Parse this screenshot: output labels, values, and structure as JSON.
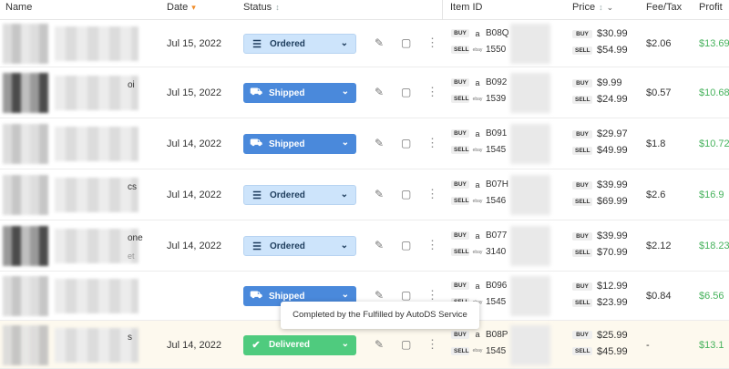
{
  "header": {
    "name": "Name",
    "date": "Date",
    "status": "Status",
    "item_id": "Item ID",
    "price": "Price",
    "fee_tax": "Fee/Tax",
    "profit": "Profit"
  },
  "labels": {
    "buy": "BUY",
    "sell": "SELL",
    "amazon_mark": "a",
    "ebay_mark": "ebay"
  },
  "orders": [
    {
      "title_fragment": "",
      "title_sub": "",
      "date": "Jul 15, 2022",
      "status": "Ordered",
      "buy_id": "B08Q",
      "sell_id": "1550",
      "buy_price": "$30.99",
      "sell_price": "$54.99",
      "fee": "$2.06",
      "profit": "$13.69"
    },
    {
      "title_fragment": "oi",
      "title_sub": "",
      "date": "Jul 15, 2022",
      "status": "Shipped",
      "buy_id": "B092",
      "sell_id": "1539",
      "buy_price": "$9.99",
      "sell_price": "$24.99",
      "fee": "$0.57",
      "profit": "$10.68"
    },
    {
      "title_fragment": "",
      "title_sub": "",
      "date": "Jul 14, 2022",
      "status": "Shipped",
      "buy_id": "B091",
      "sell_id": "1545",
      "buy_price": "$29.97",
      "sell_price": "$49.99",
      "fee": "$1.8",
      "profit": "$10.72"
    },
    {
      "title_fragment": "cs",
      "title_sub": "",
      "date": "Jul 14, 2022",
      "status": "Ordered",
      "buy_id": "B07H",
      "sell_id": "1546",
      "buy_price": "$39.99",
      "sell_price": "$69.99",
      "fee": "$2.6",
      "profit": "$16.9"
    },
    {
      "title_fragment": "one",
      "title_sub": "et",
      "date": "Jul 14, 2022",
      "status": "Ordered",
      "buy_id": "B077",
      "sell_id": "3140",
      "buy_price": "$39.99",
      "sell_price": "$70.99",
      "fee": "$2.12",
      "profit": "$18.23"
    },
    {
      "title_fragment": "",
      "title_sub": "",
      "date": "",
      "status": "Shipped",
      "buy_id": "B096",
      "sell_id": "1545",
      "buy_price": "$12.99",
      "sell_price": "$23.99",
      "fee": "$0.84",
      "profit": "$6.56"
    },
    {
      "title_fragment": "s",
      "title_sub": "",
      "date": "Jul 14, 2022",
      "status": "Delivered",
      "buy_id": "B08P",
      "sell_id": "1545",
      "buy_price": "$25.99",
      "sell_price": "$45.99",
      "fee": "-",
      "profit": "$13.1"
    }
  ],
  "tooltip": "Completed by the Fulfilled by AutoDS Service",
  "icons": {
    "ordered": "clipboard-icon",
    "shipped": "truck-icon",
    "delivered": "check-circle-icon",
    "note": "note-edit-icon",
    "memo": "sticky-note-icon",
    "more": "more-vertical-icon",
    "sort": "sort-icon",
    "amazon": "amazon-icon",
    "ebay": "ebay-icon"
  },
  "colors": {
    "ordered_bg": "#cde4fb",
    "shipped_bg": "#4a89db",
    "delivered_bg": "#4fcb7e",
    "profit": "#46b25c",
    "highlight_row": "#fdf9ee",
    "date_sort_arrow": "#f08a24"
  }
}
